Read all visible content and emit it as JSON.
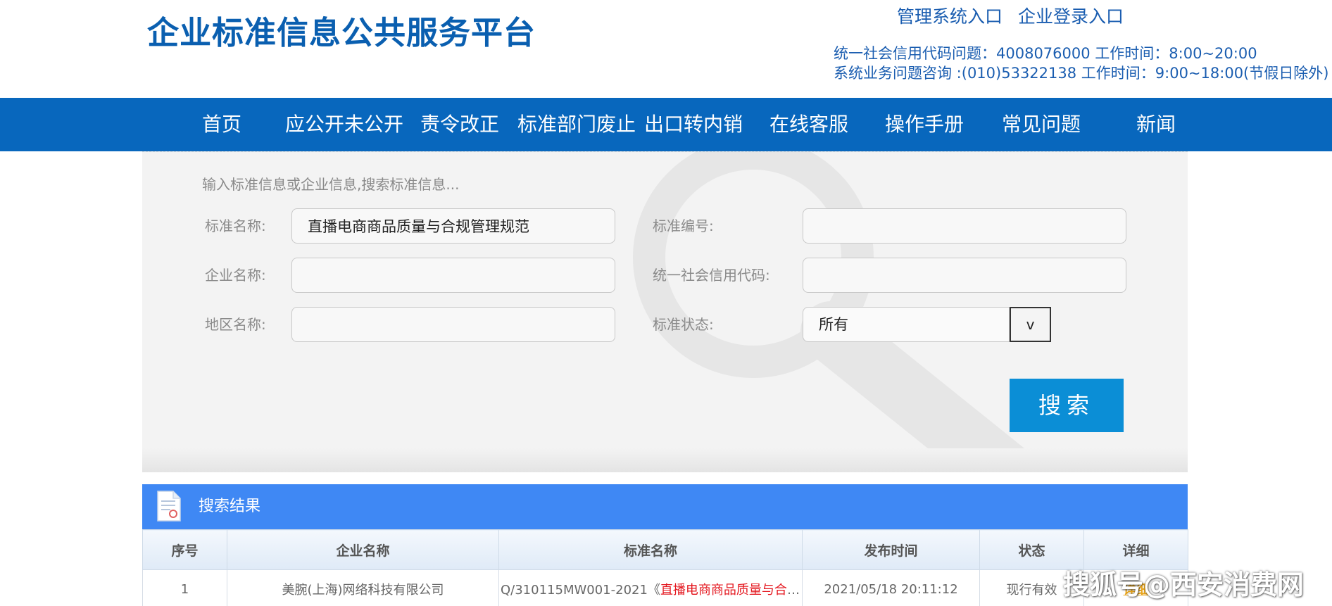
{
  "header": {
    "site_title": "企业标准信息公共服务平台",
    "links": [
      "管理系统入口",
      "企业登录入口"
    ],
    "hotline_1": "统一社会信用代码问题：4008076000 工作时间：8:00~20:00",
    "hotline_2": "系统业务问题咨询 :(010)53322138 工作时间：9:00~18:00(节假日除外)"
  },
  "nav": {
    "items": [
      "首页",
      "应公开未公开",
      "责令改正",
      "标准部门废止",
      "出口转内销",
      "在线客服",
      "操作手册",
      "常见问题",
      "新闻"
    ]
  },
  "search": {
    "hint": "输入标准信息或企业信息,搜索标准信息...",
    "fields": {
      "std_name": {
        "label": "标准名称:",
        "value": "直播电商商品质量与合规管理规范"
      },
      "std_code": {
        "label": "标准编号:",
        "value": ""
      },
      "company": {
        "label": "企业名称:",
        "value": ""
      },
      "credit_code": {
        "label": "统一社会信用代码:",
        "value": ""
      },
      "region": {
        "label": "地区名称:",
        "value": ""
      },
      "status": {
        "label": "标准状态:",
        "value": "所有"
      }
    },
    "dropdown_glyph": "v",
    "button": "搜索"
  },
  "results": {
    "title": "搜索结果",
    "columns": [
      "序号",
      "企业名称",
      "标准名称",
      "发布时间",
      "状态",
      "详细"
    ],
    "rows": [
      {
        "no": "1",
        "company": "美腕(上海)网络科技有限公司",
        "std_prefix": "Q/310115MW001-2021《",
        "std_highlight": "直播电商商品质量与合规管理规范",
        "date": "2021/05/18 20:11:12",
        "status": "现行有效",
        "detail": "详细"
      }
    ]
  },
  "watermark": "搜狐号@西安消费网",
  "colors": {
    "brand": "#0a5fb0",
    "nav": "#0867bd",
    "search_button": "#0b8ed6",
    "results_bar": "#3f88f4",
    "highlight": "#e4171f"
  }
}
